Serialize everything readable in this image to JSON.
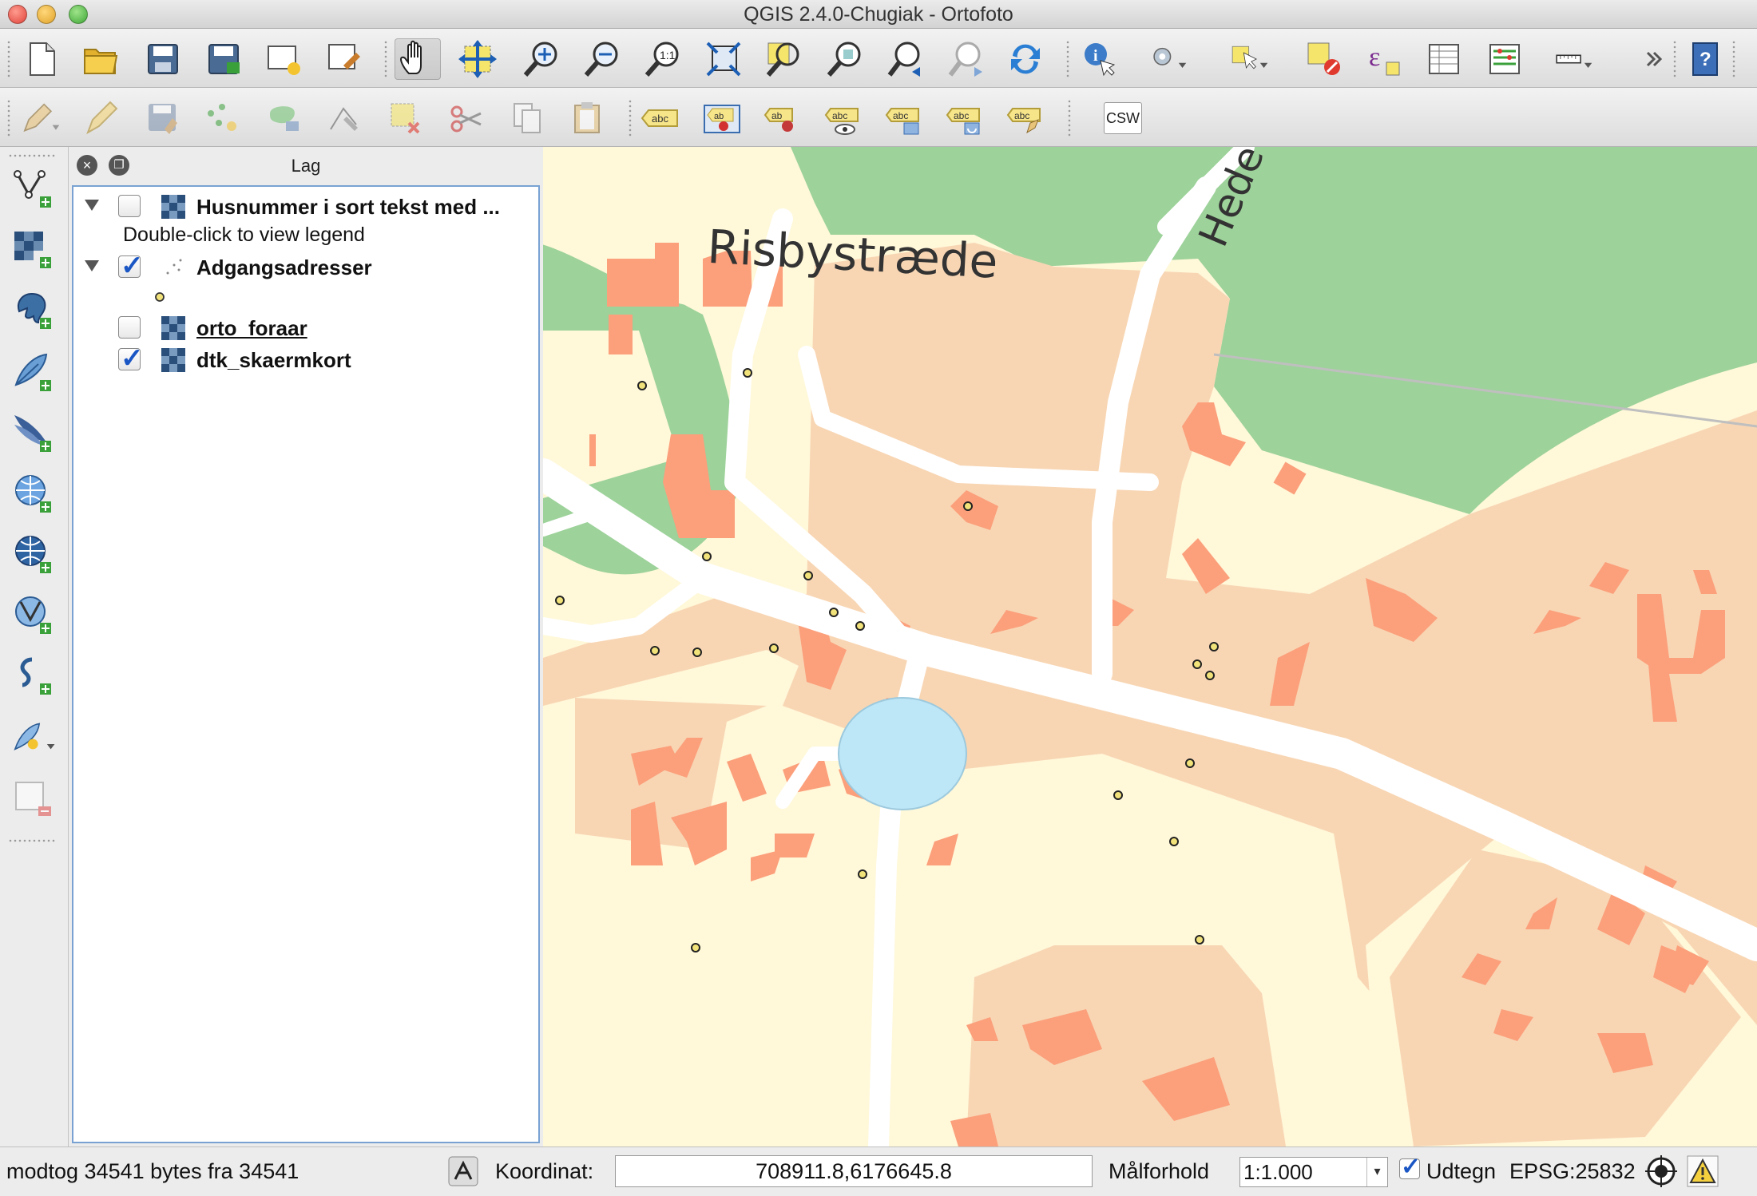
{
  "window": {
    "title": "QGIS 2.4.0-Chugiak - Ortofoto"
  },
  "toolbar1": {
    "icons": [
      "new-project-icon",
      "open-project-icon",
      "save-project-icon",
      "save-as-icon",
      "new-print-composer-icon",
      "composer-manager-icon",
      "pan-map-icon",
      "pan-to-selection-icon",
      "zoom-in-icon",
      "zoom-out-icon",
      "zoom-native-icon",
      "zoom-full-icon",
      "zoom-to-selection-icon",
      "zoom-to-layer-icon",
      "zoom-last-icon",
      "zoom-next-icon",
      "refresh-icon",
      "identify-icon",
      "action-icon",
      "select-icon",
      "deselect-icon",
      "field-calculator-icon",
      "attribute-table-icon",
      "statistics-icon",
      "measure-icon",
      "more-icon",
      "help-icon"
    ]
  },
  "toolbar2": {
    "icons": [
      "current-edits-icon",
      "toggle-editing-icon",
      "save-edits-icon",
      "add-feature-icon",
      "move-feature-icon",
      "node-tool-icon",
      "delete-selected-icon",
      "cut-features-icon",
      "copy-features-icon",
      "paste-features-icon",
      "label-icon",
      "pin-labels-icon",
      "highlight-pinned-icon",
      "show-hide-labels-icon",
      "move-label-icon",
      "rotate-label-icon",
      "change-label-icon"
    ],
    "csw_label": "CSW"
  },
  "left_tools": {
    "icons": [
      "add-vector-layer-icon",
      "add-raster-layer-icon",
      "add-postgis-layer-icon",
      "add-spatialite-layer-icon",
      "add-mssql-layer-icon",
      "add-wms-layer-icon",
      "add-wcs-layer-icon",
      "add-wfs-layer-icon",
      "add-delimited-text-icon",
      "new-shapefile-icon",
      "remove-layer-icon"
    ]
  },
  "layers_panel": {
    "title": "Lag",
    "layers": [
      {
        "name": "Husnummer i sort tekst med ...",
        "checked": false,
        "expanded": true,
        "type": "raster"
      },
      {
        "name": "Adgangsadresser",
        "checked": true,
        "expanded": true,
        "type": "point"
      },
      {
        "name": "orto_foraar",
        "checked": false,
        "expanded": false,
        "type": "raster"
      },
      {
        "name": "dtk_skaermkort",
        "checked": true,
        "expanded": false,
        "type": "raster"
      }
    ],
    "legend_hint": "Double-click to view legend"
  },
  "map": {
    "street_label_1": "Risbystræde",
    "street_label_2": "Hede",
    "colors": {
      "background": "#fff8d9",
      "built_area": "#f8d6b4",
      "building": "#fc9f7b",
      "forest": "#9dd29a",
      "road": "#ffffff",
      "water": "#bde6f7"
    }
  },
  "status": {
    "message": "modtog 34541 bytes fra 34541",
    "coord_label": "Koordinat:",
    "coord_value": "708911.8,6176645.8",
    "scale_label": "Målforhold",
    "scale_value": "1:1.000",
    "render_label": "Udtegn",
    "render_checked": true,
    "crs": "EPSG:25832"
  }
}
